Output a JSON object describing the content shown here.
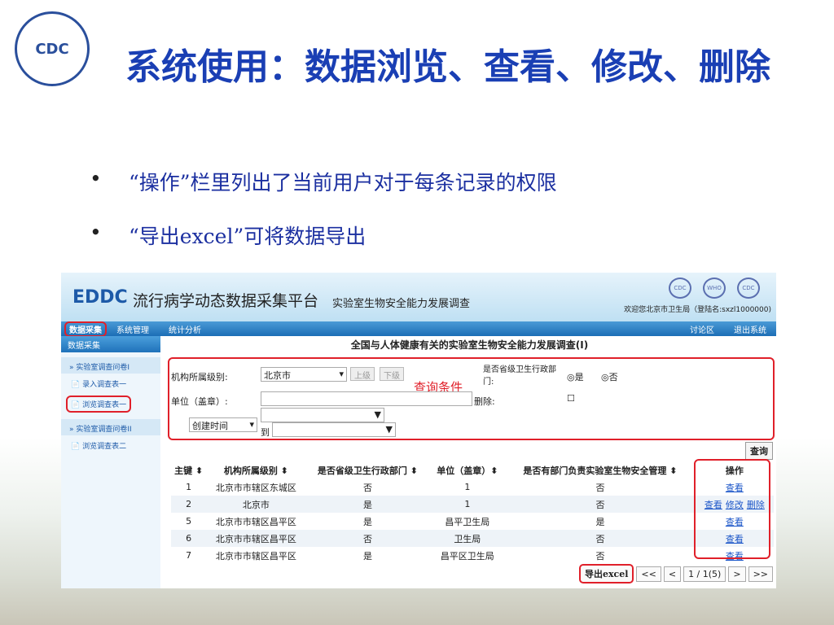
{
  "slide": {
    "logo": "CDC",
    "title": "系统使用：数据浏览、查看、修改、删除",
    "bullets": [
      "“操作”栏里列出了当前用户对于每条记录的权限",
      "“导出excel”可将数据导出"
    ]
  },
  "app": {
    "brand": "EDDC",
    "name": "流行病学动态数据采集平台",
    "survey": "实验室生物安全能力发展调查",
    "welcome": "欢迎您北京市卫生局（登陆名:sxzl1000000)",
    "logos": [
      "CDC",
      "WHO",
      "CDC"
    ],
    "nav": [
      "数据采集",
      "系统管理",
      "统计分析"
    ],
    "nav_right": [
      "讨论区",
      "退出系统"
    ],
    "sidebar": {
      "header": "数据采集",
      "groups": [
        {
          "label": "» 实验室调查问卷I",
          "items": [
            "录入调查表一",
            "浏览调查表一"
          ]
        },
        {
          "label": "» 实验室调查问卷II",
          "items": [
            "浏览调查表二"
          ]
        }
      ]
    },
    "main_title": "全国与人体健康有关的实验室生物安全能力发展调查(I)",
    "query": {
      "level_label": "机构所属级别:",
      "level_value": "北京市",
      "up": "上级",
      "down": "下级",
      "prov_label": "是否省级卫生行政部门:",
      "yes": "是",
      "no": "否",
      "unit_label": "单位（盖章）:",
      "unit_value": "",
      "delete_label": "删除:",
      "time_field": "创建时间",
      "to": "到",
      "annotation": "查询条件",
      "search": "查询"
    },
    "table": {
      "headers": [
        "主键 ⬍",
        "机构所属级别 ⬍",
        "是否省级卫生行政部门 ⬍",
        "单位（盖章）⬍",
        "是否有部门负责实验室生物安全管理 ⬍",
        "操作"
      ],
      "rows": [
        {
          "c": [
            "1",
            "北京市市辖区东城区",
            "否",
            "1",
            "否"
          ],
          "ops": [
            "查看"
          ]
        },
        {
          "c": [
            "2",
            "北京市",
            "是",
            "1",
            "否"
          ],
          "ops": [
            "查看",
            "修改",
            "删除"
          ]
        },
        {
          "c": [
            "5",
            "北京市市辖区昌平区",
            "是",
            "昌平卫生局",
            "是"
          ],
          "ops": [
            "查看"
          ]
        },
        {
          "c": [
            "6",
            "北京市市辖区昌平区",
            "否",
            "卫生局",
            "否"
          ],
          "ops": [
            "查看"
          ]
        },
        {
          "c": [
            "7",
            "北京市市辖区昌平区",
            "是",
            "昌平区卫生局",
            "否"
          ],
          "ops": [
            "查看"
          ]
        }
      ]
    },
    "pager": {
      "export": "导出excel",
      "first": "<<",
      "prev": "<",
      "page": "1 / 1(5)",
      "next": ">",
      "last": ">>"
    }
  }
}
